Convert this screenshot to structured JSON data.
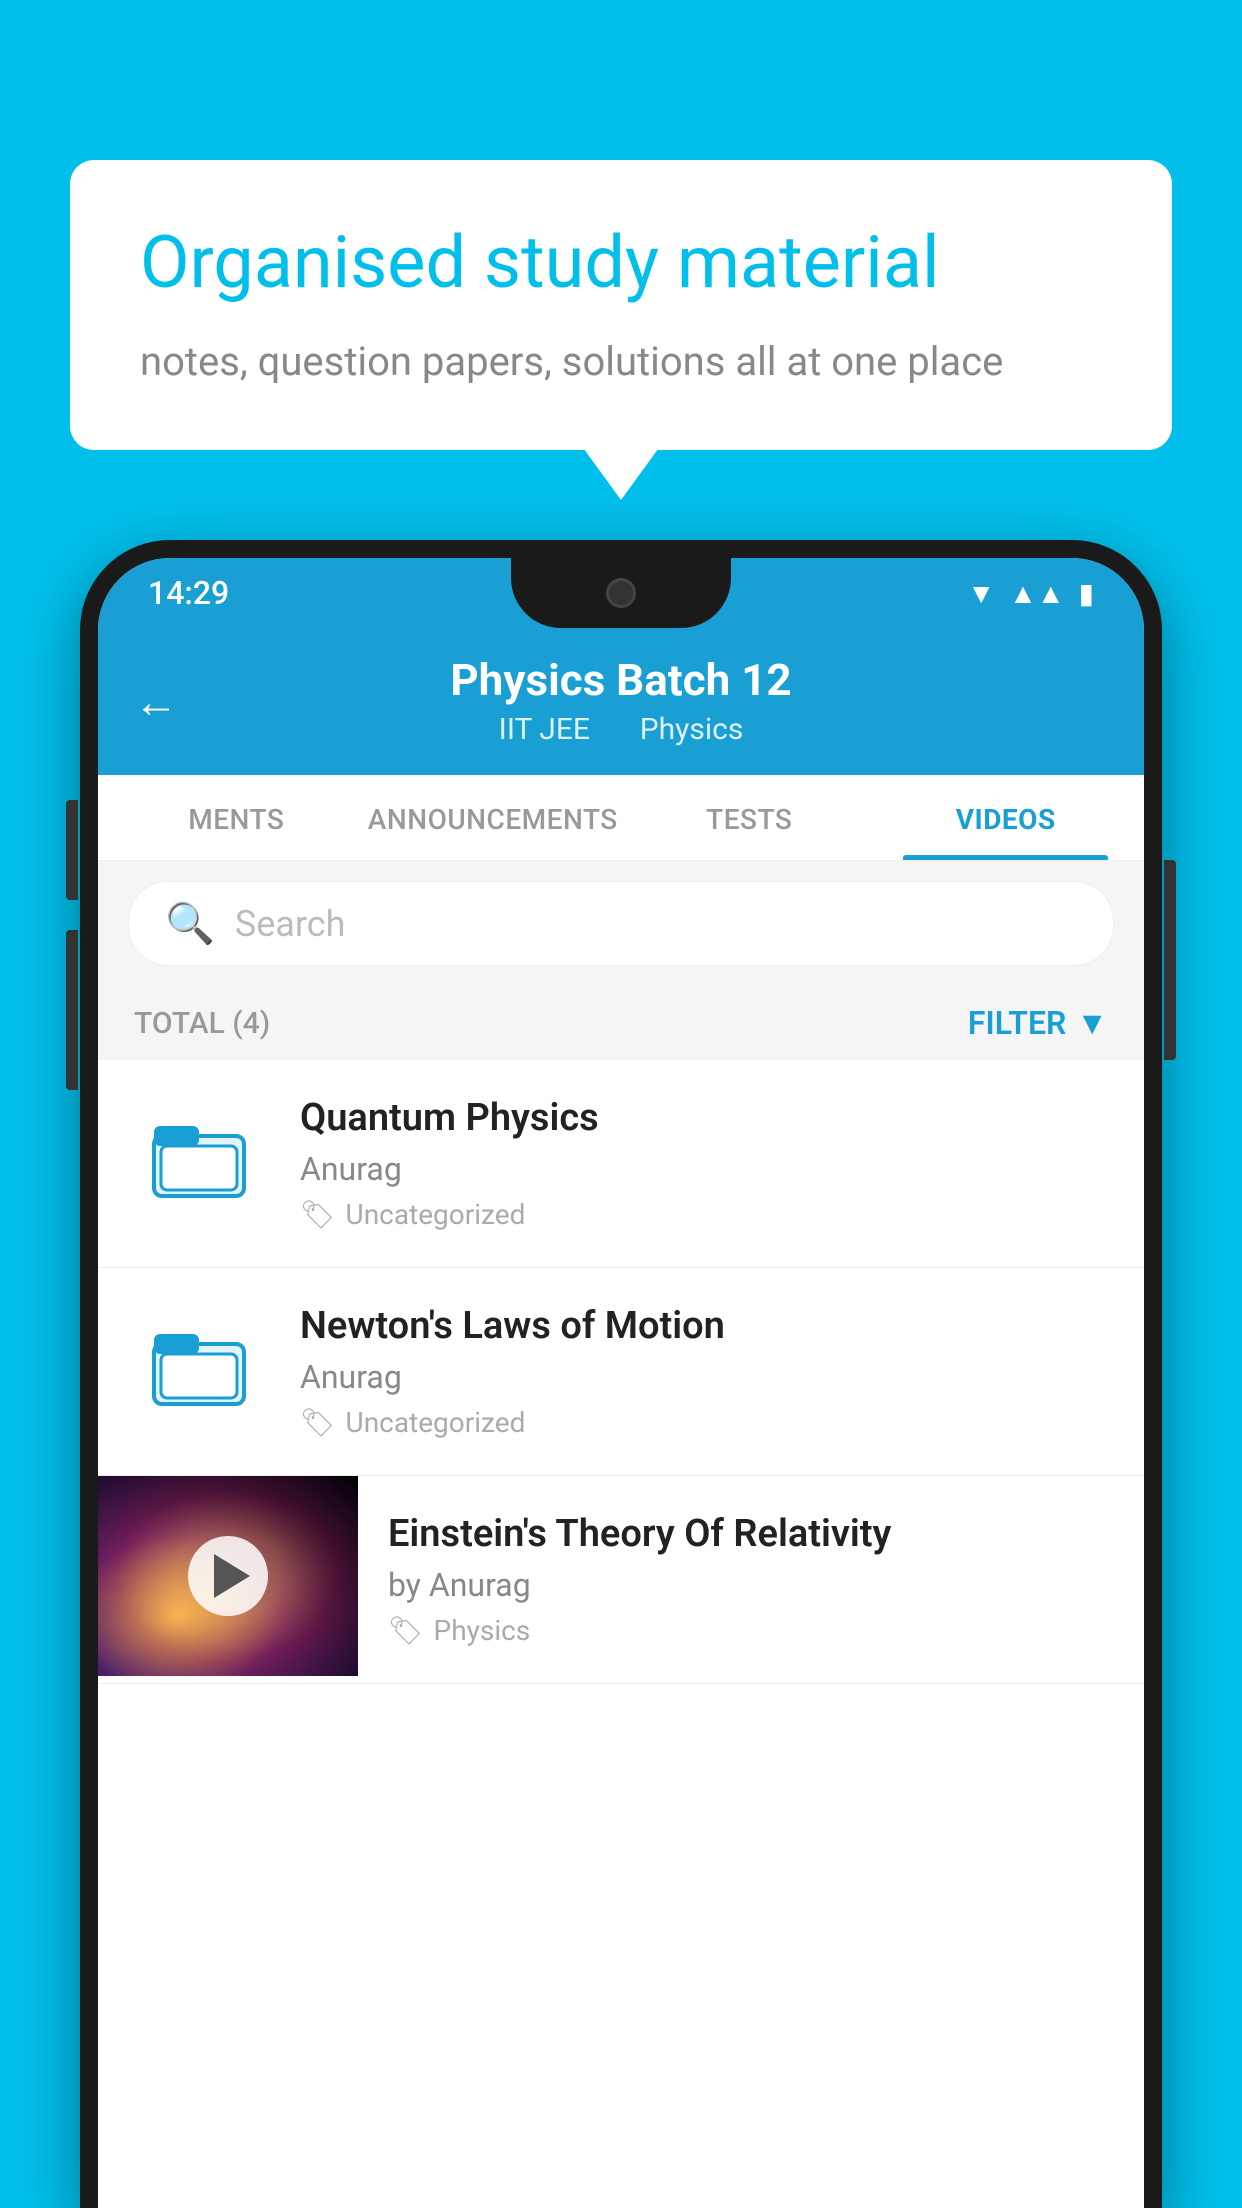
{
  "background": {
    "color": "#00BFEA"
  },
  "speech_bubble": {
    "title": "Organised study material",
    "subtitle": "notes, question papers, solutions all at one place"
  },
  "status_bar": {
    "time": "14:29"
  },
  "header": {
    "title": "Physics Batch 12",
    "subtitle_left": "IIT JEE",
    "subtitle_right": "Physics",
    "back_label": "←"
  },
  "tabs": [
    {
      "label": "MENTS",
      "active": false
    },
    {
      "label": "ANNOUNCEMENTS",
      "active": false
    },
    {
      "label": "TESTS",
      "active": false
    },
    {
      "label": "VIDEOS",
      "active": true
    }
  ],
  "search": {
    "placeholder": "Search"
  },
  "filter": {
    "total_label": "TOTAL (4)",
    "filter_label": "FILTER"
  },
  "videos": [
    {
      "id": 1,
      "title": "Quantum Physics",
      "author": "Anurag",
      "tag": "Uncategorized",
      "type": "folder"
    },
    {
      "id": 2,
      "title": "Newton's Laws of Motion",
      "author": "Anurag",
      "tag": "Uncategorized",
      "type": "folder"
    },
    {
      "id": 3,
      "title": "Einstein's Theory Of Relativity",
      "author": "by Anurag",
      "tag": "Physics",
      "type": "video"
    }
  ]
}
